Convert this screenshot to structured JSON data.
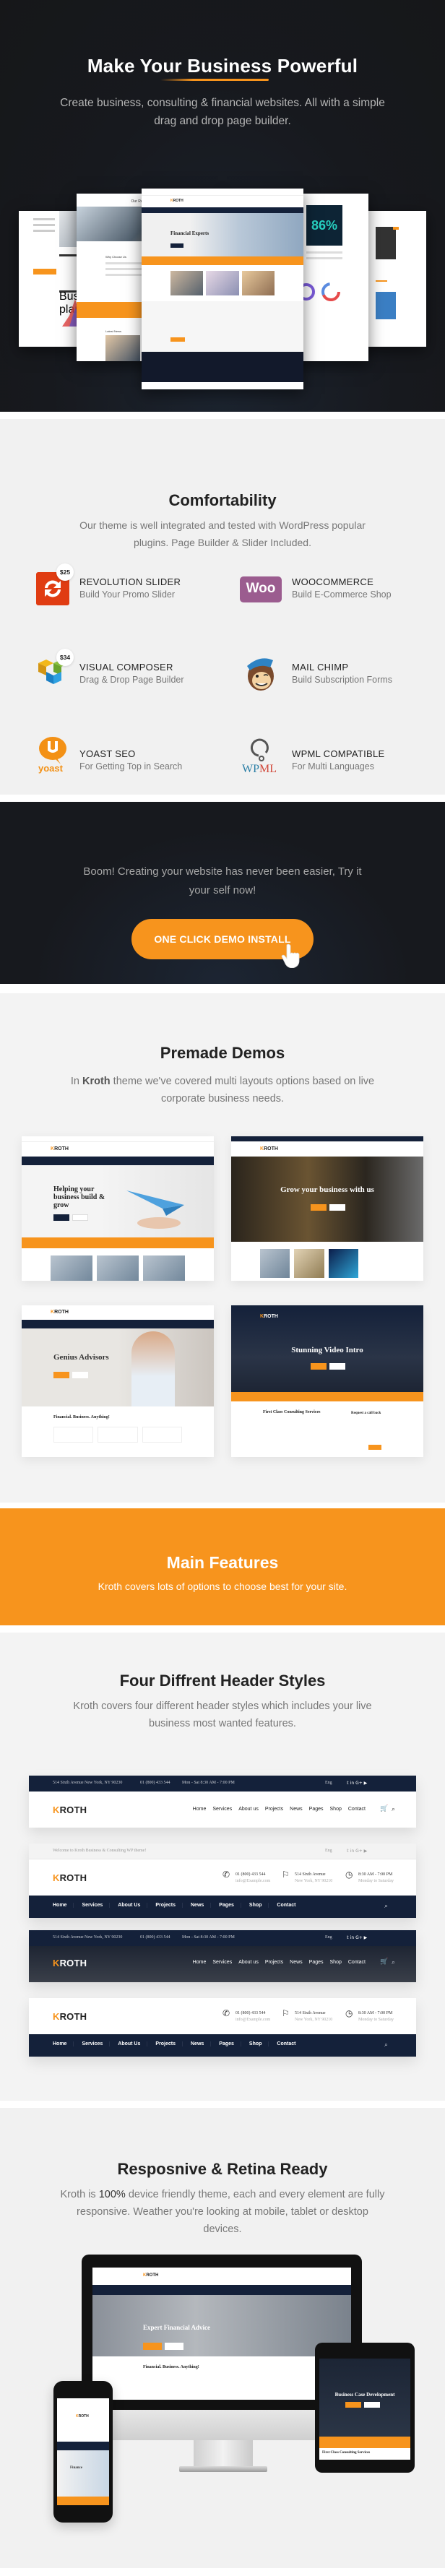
{
  "hero": {
    "title": "Make Your Business Powerful",
    "subtitle": "Create business, consulting & financial websites. All with a simple drag and drop page builder.",
    "mockups": [
      {
        "label": "Financial Experts"
      },
      {
        "label": "Our Recent Projects"
      },
      {
        "label": "Why Choose Us"
      },
      {
        "label": "Latest News"
      },
      {
        "label": "86%"
      },
      {
        "label": "Business planning"
      }
    ]
  },
  "comfort": {
    "title": "Comfortability",
    "subtitle": "Our theme is well integrated and tested with WordPress popular plugins. Page Builder & Slider Included.",
    "plugins": [
      {
        "name": "REVOLUTION SLIDER",
        "desc": "Build Your Promo Slider",
        "price": "$25",
        "icon": "revolution-slider-icon",
        "color": "#e03c12"
      },
      {
        "name": "WOOCOMMERCE",
        "desc": "Build E-Commerce Shop",
        "price": "",
        "icon": "woocommerce-icon",
        "color": "#9b5c8f",
        "logo_text": "Woo"
      },
      {
        "name": "VISUAL COMPOSER",
        "desc": "Drag & Drop Page Builder",
        "price": "$34",
        "icon": "visual-composer-icon",
        "color": "#2d8fcf"
      },
      {
        "name": "MAIL CHIMP",
        "desc": "Build Subscription Forms",
        "price": "",
        "icon": "mailchimp-icon",
        "color": "#7a4a2c"
      },
      {
        "name": "YOAST SEO",
        "desc": "For Getting Top in Search",
        "price": "",
        "icon": "yoast-icon",
        "color": "#f39116",
        "logo_text": "yoast"
      },
      {
        "name": "WPML COMPATIBLE",
        "desc": "For Multi Languages",
        "price": "",
        "icon": "wpml-icon",
        "color": "#2b7fa6",
        "logo_text": "WPML"
      }
    ]
  },
  "cta": {
    "text": "Boom! Creating your website has never been easier, Try it your self now!",
    "button": "ONE CLICK DEMO INSTALL"
  },
  "premade": {
    "title": "Premade Demos",
    "subtitle_prefix": "In ",
    "subtitle_bold": "Kroth",
    "subtitle_rest": " theme we've covered multi layouts options based on live corporate business needs.",
    "demos": [
      {
        "headline": "Helping your business build & grow"
      },
      {
        "headline": "Grow your business with us"
      },
      {
        "headline": "Genius Advisors",
        "section": "Financial. Business. Anything!"
      },
      {
        "headline": "Stunning Video Intro",
        "section": "First Class Consulting Services",
        "side": "Request a call back"
      }
    ]
  },
  "features": {
    "title": "Main Features",
    "subtitle": "Kroth covers lots of options to choose best for your site."
  },
  "headers": {
    "title": "Four Diffrent Header Styles",
    "subtitle": "Kroth covers four different header styles which includes your live business most wanted features.",
    "brand_first": "K",
    "brand_rest": "ROTH",
    "topbar": {
      "address": "514 Sixth Avenue New York, NY 90230",
      "phone": "01 (800) 433 544",
      "hours": "Mon - Sat 8:30 AM - 7:00 PM",
      "welcome": "Welcome to Kroth Business & Consulting WP theme!",
      "lang": "Eng",
      "social": [
        "twitter",
        "in",
        "G+",
        "youtube"
      ]
    },
    "menu_a": [
      "Home",
      "Services",
      "About us",
      "Projects",
      "News",
      "Pages",
      "Shop",
      "Contact"
    ],
    "menu_b": [
      "Home",
      "Services",
      "About Us",
      "Projects",
      "News",
      "Pages",
      "Shop",
      "Contact"
    ],
    "info": [
      {
        "line1": "01 (800) 433 544",
        "line2": "info@Example.com"
      },
      {
        "line1": "514 Sixth Avenue",
        "line2": "New York, NY 90210"
      },
      {
        "line1": "8:30 AM - 7:00 PM",
        "line2": "Monday to Saturday"
      }
    ]
  },
  "responsive": {
    "title": "Resposnive & Retina Ready",
    "subtitle_prefix": "Kroth is ",
    "subtitle_bold": "100%",
    "subtitle_rest": " device friendly theme, each and every element are fully responsive. Weather you're looking at mobile, tablet or desktop devices.",
    "desktop_headline": "Expert Financial Advice",
    "desktop_section": "Financial. Business. Anything!",
    "tablet_headline": "Business Case Development",
    "tablet_section": "First Class Consulting Services",
    "phone_headline": "Finance"
  },
  "colors": {
    "accent": "#f7941d",
    "navy": "#14213a",
    "dark_bg": "#17191e",
    "light_bg": "#f1f1f1"
  }
}
